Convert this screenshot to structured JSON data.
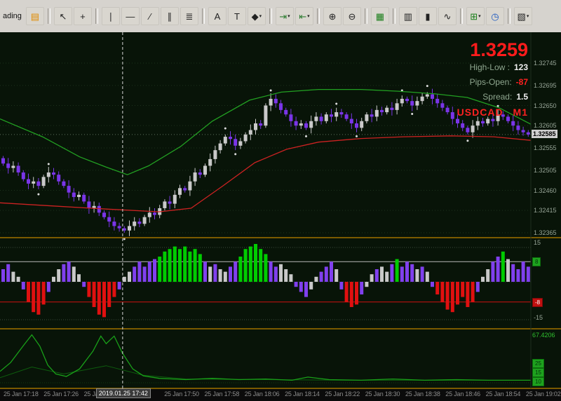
{
  "window": {
    "partial_title": "ading"
  },
  "toolbar": {
    "items": [
      {
        "type": "label",
        "name": "window-title-fragment",
        "text": "ading"
      },
      {
        "name": "market-watch-icon",
        "glyph": "▤",
        "color": "#e08a00"
      },
      {
        "type": "sep"
      },
      {
        "name": "cursor-tool",
        "glyph": "↖"
      },
      {
        "name": "crosshair-tool",
        "glyph": "+"
      },
      {
        "type": "sep"
      },
      {
        "name": "vertical-line-tool",
        "glyph": "∣"
      },
      {
        "name": "horizontal-line-tool",
        "glyph": "―"
      },
      {
        "name": "trendline-tool",
        "glyph": "∕"
      },
      {
        "name": "channel-tool",
        "glyph": "∥"
      },
      {
        "name": "fibonacci-tool",
        "glyph": "≣"
      },
      {
        "type": "sep"
      },
      {
        "name": "text-tool",
        "glyph": "A"
      },
      {
        "name": "label-tool",
        "glyph": "T"
      },
      {
        "name": "shapes-tool",
        "glyph": "◆",
        "dd": true
      },
      {
        "type": "sep"
      },
      {
        "name": "autoscroll-button",
        "glyph": "⇥",
        "color": "#2e7d32",
        "dd": true
      },
      {
        "name": "chart-shift-button",
        "glyph": "⇤",
        "color": "#2e7d32",
        "dd": true
      },
      {
        "type": "sep"
      },
      {
        "name": "zoom-in-button",
        "glyph": "⊕"
      },
      {
        "name": "zoom-out-button",
        "glyph": "⊖"
      },
      {
        "type": "sep"
      },
      {
        "name": "tile-windows-button",
        "glyph": "▦",
        "color": "#1b7f1b"
      },
      {
        "type": "sep"
      },
      {
        "name": "bar-chart-button",
        "glyph": "▥"
      },
      {
        "name": "candlestick-chart-button",
        "glyph": "▮"
      },
      {
        "name": "line-chart-button",
        "glyph": "∿"
      },
      {
        "type": "sep"
      },
      {
        "name": "new-order-button",
        "glyph": "⊞",
        "color": "#1b7f1b",
        "dd": true
      },
      {
        "name": "period-button",
        "glyph": "◷",
        "color": "#1a57c0"
      },
      {
        "type": "sep"
      },
      {
        "name": "indicators-button",
        "glyph": "▧",
        "dd": true
      }
    ]
  },
  "quote": {
    "price": "1.3259",
    "rows": [
      {
        "label": "High-Low :",
        "value": "123"
      },
      {
        "label": "Pips-Open:",
        "value": "-87"
      },
      {
        "label": "Spread:",
        "value": "1.5"
      }
    ],
    "symbol": "USDCAD",
    "timeframe": "M1"
  },
  "mid_axis": {
    "max_label": "15",
    "min_label": "-15",
    "upper_chip": "8",
    "lower_chip": "-8"
  },
  "bottom_axis": {
    "value_label": "67.4206",
    "chips": [
      "25",
      "15",
      "10"
    ]
  },
  "time_axis": {
    "labels": [
      {
        "slot": 0,
        "text": "25 Jan 17:18"
      },
      {
        "slot": 1,
        "text": "25 Jan 17:26"
      },
      {
        "slot": 2,
        "text": "25 Jan 17:34"
      },
      {
        "slot": 4,
        "text": "25 Jan 17:50"
      },
      {
        "slot": 5,
        "text": "25 Jan 17:58"
      },
      {
        "slot": 6,
        "text": "25 Jan 18:06"
      },
      {
        "slot": 7,
        "text": "25 Jan 18:14"
      },
      {
        "slot": 8,
        "text": "25 Jan 18:22"
      },
      {
        "slot": 9,
        "text": "25 Jan 18:30"
      },
      {
        "slot": 10,
        "text": "25 Jan 18:38"
      },
      {
        "slot": 11,
        "text": "25 Jan 18:46"
      },
      {
        "slot": 12,
        "text": "25 Jan 18:54"
      },
      {
        "slot": 13,
        "text": "25 Jan 19:02"
      }
    ],
    "crosshair_label": "2019.01.25 17:42"
  },
  "colors": {
    "chart_bg": "#081408",
    "bull": "#c9c9c9",
    "bear": "#7a35e8",
    "ma_upper": "#22a022",
    "ma_lower": "#cc2222",
    "hist_green": "#00cc00",
    "hist_red": "#e01010",
    "hist_purple": "#8040ee",
    "hist_silver": "#c8c8c8",
    "separator": "#7a5a00",
    "price_big": "#ff1c1c",
    "negative_value": "#ff2020",
    "vol_line": "#19a019",
    "vol_line2": "#0e5e0e"
  },
  "chart_data": {
    "type": "candlestick_with_indicators",
    "symbol": "USDCAD",
    "timeframe": "M1",
    "price_scale": {
      "labels": [
        1.32745,
        1.32695,
        1.3265,
        1.32605,
        1.32555,
        1.32505,
        1.3246,
        1.32415,
        1.32365
      ],
      "current": 1.32585
    },
    "candles_close": [
      1.3252,
      1.3251,
      1.32515,
      1.325,
      1.32485,
      1.32475,
      1.3248,
      1.3247,
      1.3249,
      1.325,
      1.32495,
      1.3248,
      1.3247,
      1.32455,
      1.32445,
      1.3245,
      1.32435,
      1.3242,
      1.32425,
      1.3241,
      1.324,
      1.3239,
      1.3238,
      1.32375,
      1.3237,
      1.3238,
      1.3239,
      1.32385,
      1.324,
      1.3241,
      1.32405,
      1.3242,
      1.32435,
      1.3243,
      1.3245,
      1.32465,
      1.3246,
      1.3248,
      1.325,
      1.32495,
      1.32515,
      1.3253,
      1.3255,
      1.32565,
      1.3258,
      1.32575,
      1.3256,
      1.3257,
      1.32585,
      1.32595,
      1.3261,
      1.32605,
      1.3265,
      1.32665,
      1.32655,
      1.3264,
      1.3263,
      1.32615,
      1.32605,
      1.3261,
      1.326,
      1.32615,
      1.32625,
      1.32615,
      1.3263,
      1.32625,
      1.32635,
      1.3263,
      1.3262,
      1.3261,
      1.326,
      1.32615,
      1.3263,
      1.32625,
      1.3264,
      1.32635,
      1.32645,
      1.3264,
      1.32655,
      1.32665,
      1.3266,
      1.3265,
      1.3266,
      1.3267,
      1.32675,
      1.32665,
      1.32655,
      1.32645,
      1.32635,
      1.3262,
      1.3261,
      1.326,
      1.3259,
      1.32605,
      1.32615,
      1.3261,
      1.3262,
      1.32615,
      1.3263,
      1.32625,
      1.32615,
      1.32605,
      1.32595,
      1.3259,
      1.32585
    ],
    "ma_upper": {
      "color": "#22a022",
      "points": [
        [
          0,
          1.3262
        ],
        [
          0.08,
          1.3258
        ],
        [
          0.15,
          1.32535
        ],
        [
          0.2,
          1.32512
        ],
        [
          0.24,
          1.32495
        ],
        [
          0.28,
          1.32515
        ],
        [
          0.34,
          1.32558
        ],
        [
          0.4,
          1.32615
        ],
        [
          0.47,
          1.32662
        ],
        [
          0.53,
          1.3268
        ],
        [
          0.6,
          1.32686
        ],
        [
          0.68,
          1.32686
        ],
        [
          0.75,
          1.32682
        ],
        [
          0.82,
          1.32676
        ],
        [
          0.88,
          1.32668
        ],
        [
          0.94,
          1.32645
        ],
        [
          1.0,
          1.32608
        ]
      ]
    },
    "ma_lower": {
      "color": "#cc2222",
      "points": [
        [
          0,
          1.32432
        ],
        [
          0.1,
          1.32425
        ],
        [
          0.2,
          1.32418
        ],
        [
          0.3,
          1.32412
        ],
        [
          0.36,
          1.3242
        ],
        [
          0.42,
          1.3247
        ],
        [
          0.48,
          1.32522
        ],
        [
          0.54,
          1.32552
        ],
        [
          0.6,
          1.32568
        ],
        [
          0.68,
          1.32576
        ],
        [
          0.76,
          1.3258
        ],
        [
          0.85,
          1.32582
        ],
        [
          0.93,
          1.3258
        ],
        [
          1.0,
          1.32572
        ]
      ]
    },
    "histogram": {
      "levels": {
        "upper": 8,
        "lower": -8,
        "max": 15,
        "min": -15
      },
      "values": [
        5,
        7,
        4,
        2,
        -3,
        -8,
        -12,
        -13,
        -9,
        -4,
        2,
        5,
        7,
        8,
        6,
        3,
        -2,
        -6,
        -10,
        -13,
        -14,
        -10,
        -6,
        -3,
        2,
        4,
        6,
        8,
        6,
        8,
        9,
        10,
        12,
        13,
        14,
        13,
        14,
        12,
        13,
        11,
        8,
        6,
        7,
        5,
        4,
        6,
        8,
        10,
        13,
        14,
        15,
        13,
        11,
        8,
        6,
        7,
        5,
        3,
        -2,
        -4,
        -6,
        -3,
        2,
        4,
        6,
        8,
        5,
        -3,
        -8,
        -10,
        -9,
        -5,
        -2,
        3,
        5,
        6,
        4,
        7,
        9,
        6,
        8,
        7,
        5,
        6,
        4,
        -2,
        -5,
        -8,
        -11,
        -12,
        -9,
        -6,
        -10,
        -8,
        -4,
        2,
        5,
        8,
        10,
        12,
        9,
        7,
        5,
        8,
        6
      ],
      "colors": [
        "ppwwprrrrp",
        "wwppwwprrr",
        "rrrpwwpppp",
        "pggggggggg",
        "pwpwwppggg",
        "gggppwwwpp",
        "pwwpppwprr",
        "rpwwpwwpgp",
        "ppwpwprrrr",
        "rrrrpwwppg",
        "wpppp"
      ]
    },
    "volatility_line": {
      "color": "#19a019",
      "current_label": "67.4206",
      "points": [
        [
          0,
          18
        ],
        [
          0.02,
          32
        ],
        [
          0.045,
          60
        ],
        [
          0.06,
          76
        ],
        [
          0.075,
          58
        ],
        [
          0.09,
          28
        ],
        [
          0.105,
          14
        ],
        [
          0.125,
          10
        ],
        [
          0.15,
          22
        ],
        [
          0.175,
          50
        ],
        [
          0.19,
          74
        ],
        [
          0.2,
          62
        ],
        [
          0.215,
          74
        ],
        [
          0.23,
          48
        ],
        [
          0.25,
          22
        ],
        [
          0.27,
          11
        ],
        [
          0.3,
          7
        ],
        [
          0.35,
          5
        ],
        [
          0.4,
          7
        ],
        [
          0.45,
          5
        ],
        [
          0.5,
          6
        ],
        [
          0.55,
          4
        ],
        [
          0.58,
          9
        ],
        [
          0.62,
          5
        ],
        [
          0.68,
          4
        ],
        [
          0.74,
          6
        ],
        [
          0.8,
          4
        ],
        [
          0.86,
          5
        ],
        [
          0.92,
          4
        ],
        [
          1.0,
          4
        ]
      ]
    },
    "volatility_line2": {
      "color": "#0e5e0e",
      "points": [
        [
          0,
          8
        ],
        [
          0.06,
          25
        ],
        [
          0.12,
          14
        ],
        [
          0.2,
          27
        ],
        [
          0.27,
          12
        ],
        [
          0.35,
          6
        ],
        [
          0.5,
          5
        ],
        [
          0.65,
          4
        ],
        [
          0.8,
          4
        ],
        [
          1.0,
          4
        ]
      ]
    },
    "crosshair": {
      "x_frac": 0.231,
      "time_label": "2019.01.25 17:42"
    }
  }
}
